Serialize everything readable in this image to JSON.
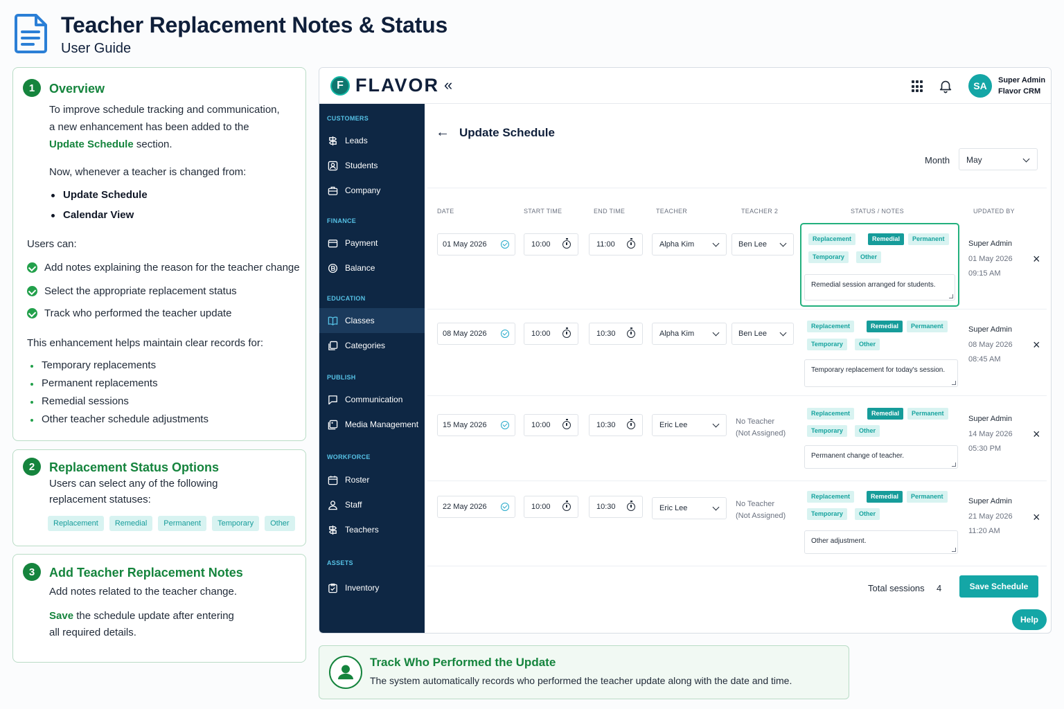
{
  "header": {
    "title": "Teacher Replacement Notes & Status",
    "subtitle": "User Guide"
  },
  "guide": {
    "overview": {
      "num": "1",
      "title": "Overview",
      "p1_a": "To improve schedule tracking and communication,",
      "p1_b": "a new enhancement has been added to the",
      "p1_highlight": "Update Schedule",
      "p1_end": "section.",
      "p2": "Now, whenever a teacher is changed from:",
      "sources": [
        "Update Schedule",
        "Calendar View"
      ],
      "users_can": "Users can:",
      "abilities": [
        "Add notes explaining the reason for the teacher change",
        "Select the appropriate replacement status",
        "Track who performed the teacher update"
      ],
      "helps": "This enhancement helps maintain clear records for:",
      "records": [
        "Temporary replacements",
        "Permanent replacements",
        "Remedial sessions",
        "Other teacher schedule adjustments"
      ]
    },
    "status_options": {
      "num": "2",
      "title": "Replacement Status Options",
      "p1": "Users can select any of the following",
      "p2": "replacement statuses:",
      "options": [
        "Replacement",
        "Remedial",
        "Permanent",
        "Temporary",
        "Other"
      ]
    },
    "notes": {
      "num": "3",
      "title": "Add Teacher Replacement Notes",
      "p1": "Add notes related to the teacher change.",
      "save_word": "Save",
      "p2_rest": "the schedule update after entering",
      "p3": "all required details."
    }
  },
  "app": {
    "logo_letter": "F",
    "logo_text": "FLAVOR",
    "collapse": "«",
    "user": {
      "initials": "SA",
      "name": "Super Admin",
      "org": "Flavor CRM"
    },
    "sidebar": {
      "groups": {
        "customers": "CUSTOMERS",
        "finance": "FINANCE",
        "education": "EDUCATION",
        "publish": "PUBLISH",
        "workforce": "WORKFORCE",
        "assets": "ASSETS"
      },
      "items": {
        "leads": "Leads",
        "students": "Students",
        "company": "Company",
        "payment": "Payment",
        "balance": "Balance",
        "classes": "Classes",
        "categories": "Categories",
        "communication": "Communication",
        "media": "Media Management",
        "roster": "Roster",
        "staff": "Staff",
        "teachers": "Teachers",
        "inventory": "Inventory"
      }
    },
    "page": {
      "back": "←",
      "title": "Update Schedule",
      "month_label": "Month",
      "month_value": "May"
    },
    "columns": {
      "date": "DATE",
      "start": "START TIME",
      "end": "END TIME",
      "teacher": "TEACHER",
      "teacher2": "TEACHER 2",
      "status": "STATUS / NOTES",
      "updated": "UPDATED BY"
    },
    "status_tags": [
      "Replacement",
      "Remedial",
      "Permanent",
      "Temporary",
      "Other"
    ],
    "active_status": "Remedial",
    "rows": [
      {
        "date": "01 May 2026",
        "start": "10:00",
        "end": "11:00",
        "teacher": "Alpha Kim",
        "teacher2": "Ben Lee",
        "note": "Remedial session arranged for students.",
        "updated_by": "Super Admin",
        "updated_date": "01 May 2026",
        "updated_time": "09:15 AM"
      },
      {
        "date": "08 May 2026",
        "start": "10:00",
        "end": "10:30",
        "teacher": "Alpha Kim",
        "teacher2": "Ben Lee",
        "note": "Temporary replacement for today's session.",
        "updated_by": "Super Admin",
        "updated_date": "08 May 2026",
        "updated_time": "08:45 AM"
      },
      {
        "date": "15 May 2026",
        "start": "10:00",
        "end": "10:30",
        "teacher": "Eric Lee",
        "teacher2_line1": "No Teacher",
        "teacher2_line2": "(Not Assigned)",
        "note": "Permanent change of teacher.",
        "updated_by": "Super Admin",
        "updated_date": "14 May 2026",
        "updated_time": "05:30 PM"
      },
      {
        "date": "22 May 2026",
        "start": "10:00",
        "end": "10:30",
        "teacher": "Eric Lee",
        "teacher2_line1": "No Teacher",
        "teacher2_line2": "(Not Assigned)",
        "note": "Other adjustment.",
        "updated_by": "Super Admin",
        "updated_date": "21 May 2026",
        "updated_time": "11:20 AM"
      }
    ],
    "remove": "×",
    "total_label": "Total sessions",
    "total_value": "4",
    "save_label": "Save Schedule",
    "help_label": "Help"
  },
  "track": {
    "title": "Track Who Performed the Update",
    "text": "The system automatically records who performed the teacher update along with the date and time."
  },
  "colors": {
    "brand_teal": "#14a6a6",
    "guide_green": "#15843d",
    "sidebar_navy": "#0e2744"
  }
}
